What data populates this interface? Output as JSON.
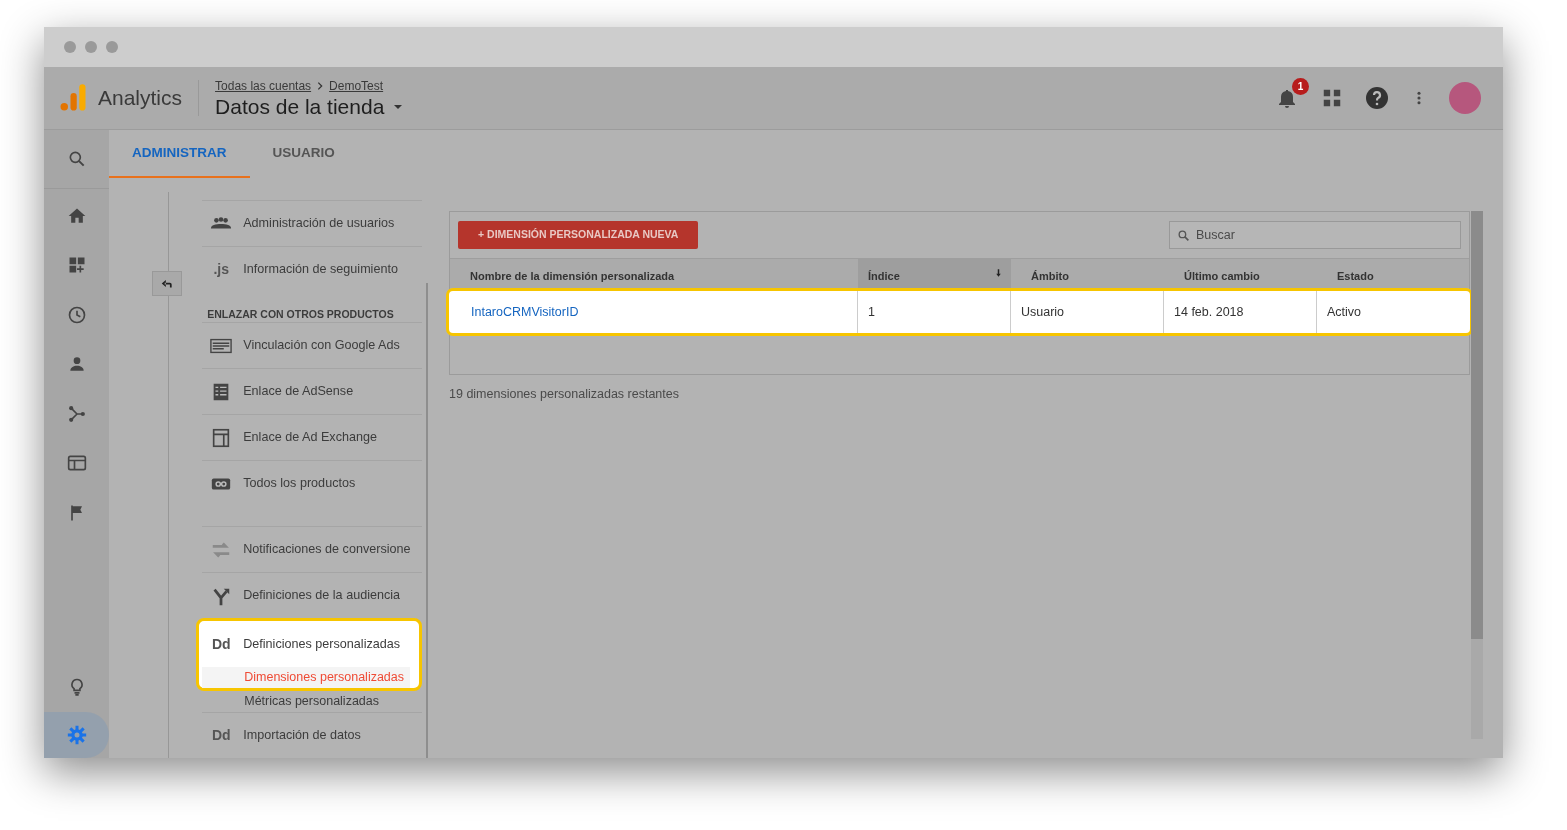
{
  "header": {
    "product": "Analytics",
    "breadcrumb": [
      "Todas las cuentas",
      "DemoTest"
    ],
    "view": "Datos de la tienda",
    "notifications": "1"
  },
  "rail": [
    {
      "kind": "search",
      "selected": false
    },
    {
      "kind": "home",
      "selected": false
    },
    {
      "kind": "dashboard",
      "selected": false
    },
    {
      "kind": "clock",
      "selected": false
    },
    {
      "kind": "person",
      "selected": false
    },
    {
      "kind": "branch",
      "selected": false
    },
    {
      "kind": "window",
      "selected": false
    },
    {
      "kind": "flag",
      "selected": false
    },
    {
      "kind": "bulb",
      "selected": false
    },
    {
      "kind": "gear",
      "selected": true
    }
  ],
  "tabs": [
    {
      "label": "ADMINISTRAR",
      "selected": true
    },
    {
      "label": "USUARIO",
      "selected": false
    }
  ],
  "nav": [
    {
      "kind": "item",
      "label": "Administración de usuarios"
    },
    {
      "kind": "item",
      "icon_text": ".js",
      "label": "Información de seguimiento"
    },
    {
      "kind": "section",
      "label": "ENLAZAR CON OTROS PRODUCTOS"
    },
    {
      "kind": "item",
      "label": "Vinculación con Google Ads"
    },
    {
      "kind": "item",
      "label": "Enlace de AdSense"
    },
    {
      "kind": "item",
      "label": "Enlace de Ad Exchange"
    },
    {
      "kind": "item",
      "label": "Todos los productos"
    },
    {
      "kind": "spacer"
    },
    {
      "kind": "item",
      "label": "Notificaciones de conversione"
    },
    {
      "kind": "item",
      "label": "Definiciones de la audiencia"
    },
    {
      "kind": "item",
      "icon_text": "Dd",
      "label": "Definiciones personalizadas",
      "highlighted": true,
      "children": [
        {
          "label": "Dimensiones personalizadas",
          "selected": true,
          "highlighted": true
        },
        {
          "label": "Métricas personalizadas",
          "selected": false,
          "highlighted": false
        }
      ]
    },
    {
      "kind": "item",
      "icon_text": "Dd",
      "label": "Importación de datos"
    }
  ],
  "table": {
    "new_button": "+ DIMENSIÓN PERSONALIZADA NUEVA",
    "search": {
      "placeholder": "Buscar"
    },
    "columns": [
      {
        "label": "Nombre de la dimensión personalizada",
        "sorted": false
      },
      {
        "label": "Índice",
        "sorted": true
      },
      {
        "label": "Ámbito",
        "sorted": false
      },
      {
        "label": "Último cambio",
        "sorted": false
      },
      {
        "label": "Estado",
        "sorted": false
      }
    ],
    "rows": [
      {
        "highlighted": true,
        "cells": [
          "IntaroCRMVisitorID",
          "1",
          "Usuario",
          "14 feb. 2018",
          "Activo"
        ]
      }
    ],
    "footer": "19 dimensiones personalizadas restantes"
  }
}
